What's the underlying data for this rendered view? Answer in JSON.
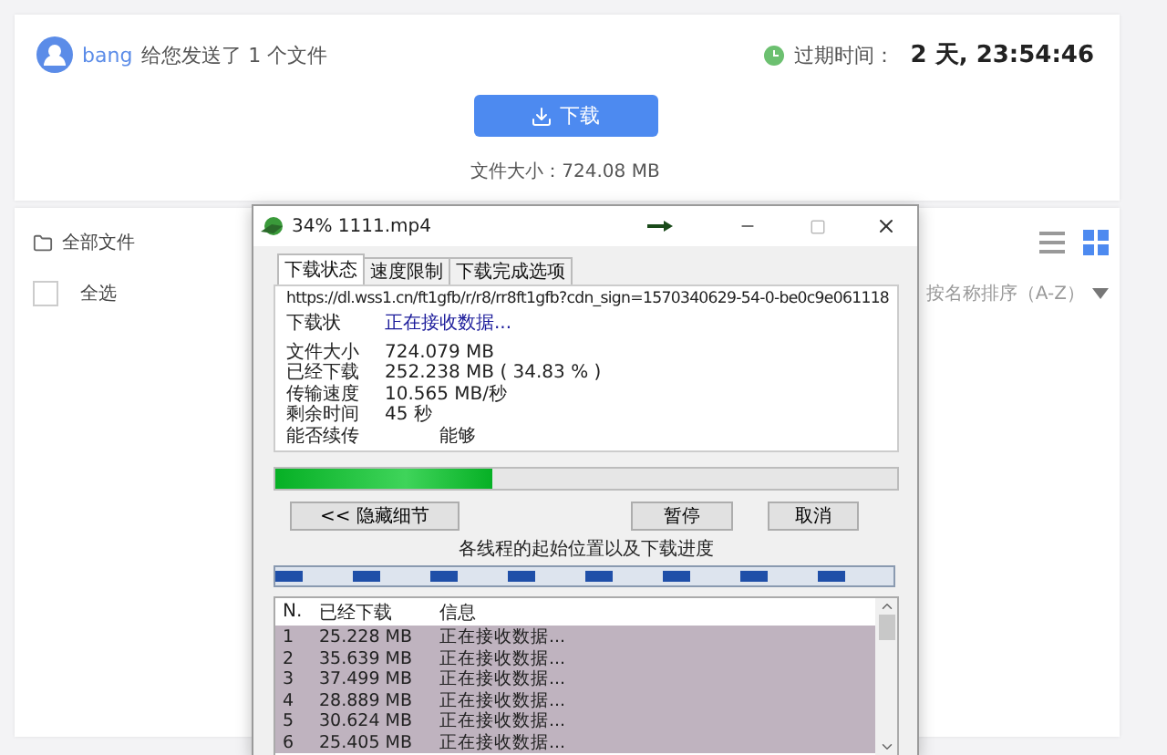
{
  "header": {
    "sender": "bang",
    "message": "给您发送了 1 个文件",
    "expiry_label": "过期时间：",
    "expiry_value": "2 天, 23:54:46",
    "download_button": "下载",
    "file_size": "文件大小：724.08 MB"
  },
  "files": {
    "breadcrumb": "全部文件",
    "select_all": {
      "label": "全选",
      "checked": false
    },
    "sort": "按名称排序（A-Z）",
    "views": [
      {
        "kind": "list",
        "selected": false
      },
      {
        "kind": "grid",
        "selected": true
      }
    ]
  },
  "dialog": {
    "title": "34% 1111.mp4",
    "tabs": [
      {
        "label": "下载状态",
        "selected": true
      },
      {
        "label": "速度限制",
        "selected": false
      },
      {
        "label": "下载完成选项",
        "selected": false
      }
    ],
    "url": "https://dl.wss1.cn/ft1gfb/r/r8/rr8ft1gfb?cdn_sign=1570340629-54-0-be0c9e061118",
    "status_label": "下载状",
    "status_value": "正在接收数据...",
    "fields": [
      {
        "label": "文件大小",
        "value": "724.079  MB"
      },
      {
        "label": "已经下载",
        "value": "252.238  MB  ( 34.83 % )"
      },
      {
        "label": "传输速度",
        "value": "10.565  MB/秒"
      },
      {
        "label": "剩余时间",
        "value": "45 秒"
      },
      {
        "label": "能否续传",
        "value": "能够"
      }
    ],
    "progress": {
      "level": 0.35
    },
    "hide_details": "<< 隐藏细节",
    "pause": "暂停",
    "cancel": "取消",
    "threads_caption": "各线程的起始位置以及下载进度",
    "columns": [
      "N.",
      "已经下载",
      "信息"
    ],
    "rows": [
      {
        "n": "1",
        "downloaded": "25.228 MB",
        "info": "正在接收数据...",
        "selected": true
      },
      {
        "n": "2",
        "downloaded": "35.639 MB",
        "info": "正在接收数据...",
        "selected": true
      },
      {
        "n": "3",
        "downloaded": "37.499 MB",
        "info": "正在接收数据...",
        "selected": true
      },
      {
        "n": "4",
        "downloaded": "28.889 MB",
        "info": "正在接收数据...",
        "selected": true
      },
      {
        "n": "5",
        "downloaded": "30.624 MB",
        "info": "正在接收数据...",
        "selected": true
      },
      {
        "n": "6",
        "downloaded": "25.405 MB",
        "info": "正在接收数据...",
        "selected": true
      }
    ]
  }
}
